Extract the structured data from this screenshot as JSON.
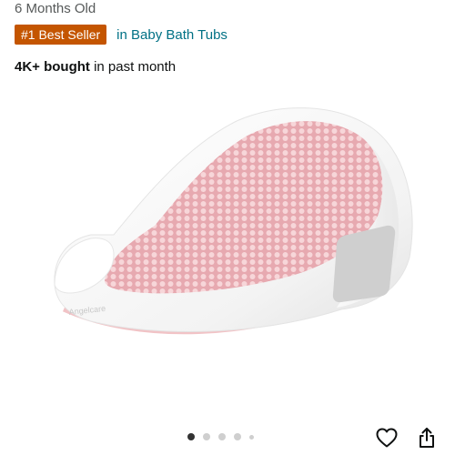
{
  "product": {
    "age_line": "6 Months Old",
    "best_seller_badge": "#1 Best Seller",
    "best_seller_category": "in Baby Bath Tubs",
    "bought_count": "4K+ bought",
    "bought_suffix": " in past month",
    "brand_on_image": "Angelcare"
  },
  "carousel": {
    "total_images": 5,
    "active_index": 0
  },
  "actions": {
    "favorite_icon": "heart-icon",
    "share_icon": "share-icon"
  },
  "colors": {
    "badge_bg": "#c45500",
    "link": "#007185",
    "seat_pink": "#f1c3c6"
  }
}
